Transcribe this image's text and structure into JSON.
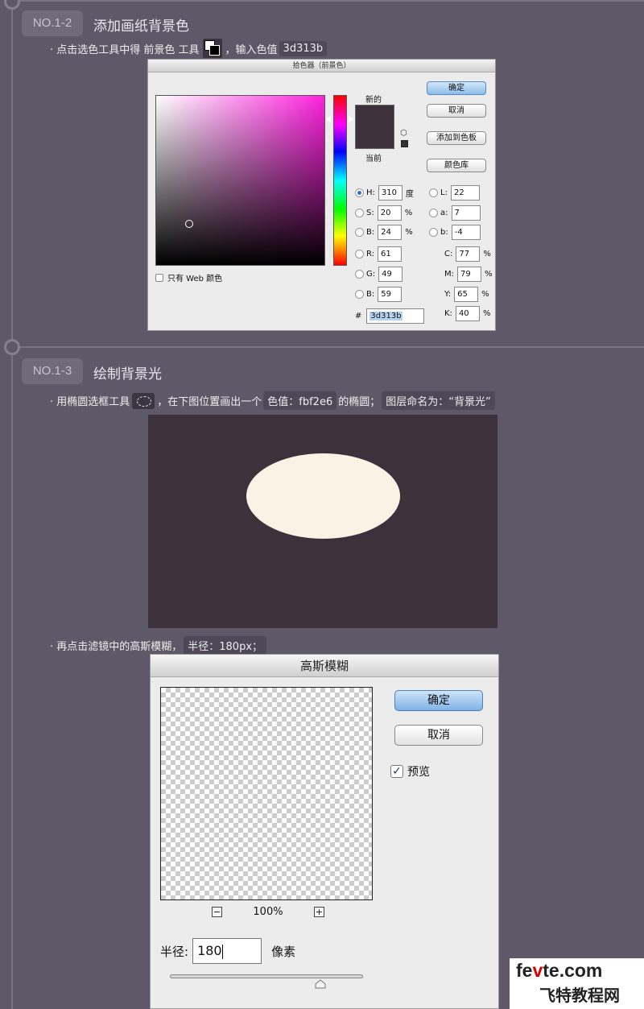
{
  "step1": {
    "badge": "NO.1-2",
    "title": "添加画纸背景色",
    "instr_prefix": "· 点击选色工具中得 前景色 工具",
    "instr_suffix": "，输入色值",
    "color_value": "3d313b"
  },
  "picker": {
    "title": "拾色器（前景色）",
    "label_new": "新的",
    "label_current": "当前",
    "ok": "确定",
    "cancel": "取消",
    "add_swatch": "添加到色板",
    "color_library": "颜色库",
    "web_only": "只有 Web 颜色",
    "new_color": "#3d313b",
    "hsb": {
      "h_label": "H:",
      "h": "310",
      "h_unit": "度",
      "s_label": "S:",
      "s": "20",
      "s_unit": "%",
      "b_label": "B:",
      "b": "24",
      "b_unit": "%"
    },
    "lab": {
      "l_label": "L:",
      "l": "22",
      "a_label": "a:",
      "a": "7",
      "b_label": "b:",
      "b": "-4"
    },
    "rgb": {
      "r_label": "R:",
      "r": "61",
      "g_label": "G:",
      "g": "49",
      "b_label": "B:",
      "b": "59"
    },
    "cmyk": {
      "c_label": "C:",
      "c": "77",
      "m_label": "M:",
      "m": "79",
      "y_label": "Y:",
      "y": "65",
      "k_label": "K:",
      "k": "40",
      "unit": "%"
    },
    "hex_label": "#",
    "hex": "3d313b"
  },
  "step2": {
    "badge": "NO.1-3",
    "title": "绘制背景光",
    "instr_prefix": "· 用椭圆选框工具",
    "instr_mid": "，在下图位置画出一个",
    "color_value": "色值：fbf2e6",
    "instr_after_color": "的椭圆；",
    "layer_name": "图层命名为：“背景光”",
    "canvas_bg": "#3d313b",
    "ellipse_color": "#fbf2e6",
    "instr2_prefix": "· 再点击滤镜中的高斯模糊，",
    "radius_hint": "半径：180px；"
  },
  "blur": {
    "title": "高斯模糊",
    "ok": "确定",
    "cancel": "取消",
    "preview_label": "预览",
    "preview_checked": true,
    "zoom": "100%",
    "zoom_out": "−",
    "zoom_in": "+",
    "radius_label": "半径:",
    "radius_value": "180",
    "radius_unit": "像素",
    "check_mark": "✓"
  },
  "watermark": {
    "line1_a": "fe",
    "line1_o": "v",
    "line1_b": "te.com",
    "line2": "飞特教程网"
  }
}
